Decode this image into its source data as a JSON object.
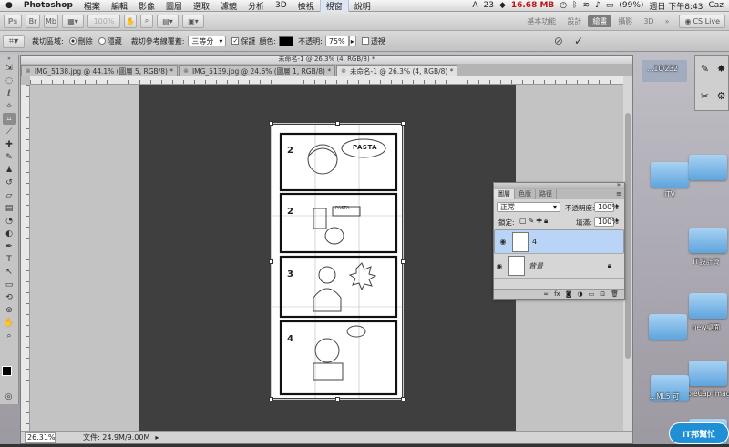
{
  "menubar": {
    "app_name": "Photoshop",
    "menus": [
      "檔案",
      "編輯",
      "影像",
      "圖層",
      "選取",
      "濾鏡",
      "分析",
      "3D",
      "檢視",
      "視窗",
      "說明"
    ],
    "status": {
      "adobe_count": "23",
      "memory": "16.68 MB",
      "battery": "(99%)",
      "datetime": "週日 下午8:43",
      "user": "Caz"
    }
  },
  "appbar": {
    "zoom_value": "100%",
    "workspaces": [
      "基本功能",
      "設計",
      "繪畫",
      "攝影",
      "3D"
    ],
    "active_workspace": "繪畫",
    "cs_live": "CS Live"
  },
  "options": {
    "crop_area_label": "裁切區域:",
    "delete_label": "刪除",
    "hide_label": "隱藏",
    "overlay_label": "裁切參考線覆蓋:",
    "overlay_value": "三等分",
    "shield_label": "保護",
    "color_label": "顏色:",
    "opacity_label": "不透明:",
    "opacity_value": "75%",
    "perspective_label": "透視",
    "cancel_glyph": "⊘",
    "commit_glyph": "✓"
  },
  "document": {
    "window_title": "未命名-1 @ 26.3% (4, RGB/8) *",
    "tabs": [
      {
        "label": "IMG_5138.jpg @ 44.1% (圖層 5, RGB/8) *",
        "active": false
      },
      {
        "label": "IMG_5139.jpg @ 24.6% (圖層 1, RGB/8) *",
        "active": false
      },
      {
        "label": "未命名-1 @ 26.3% (4, RGB/8) *",
        "active": true
      }
    ],
    "zoom": "26.31%",
    "file_info": "文件: 24.9M/9.00M"
  },
  "comic": {
    "panel_numbers": [
      "2",
      "2",
      "3",
      "4"
    ],
    "bubble_text": "PASTA",
    "small_text": "PASTA"
  },
  "layers_panel": {
    "tabs": [
      "圖層",
      "色版",
      "路徑"
    ],
    "blend_mode": "正常",
    "opacity_label": "不透明度:",
    "opacity_value": "100%",
    "lock_label": "鎖定:",
    "fill_label": "填滿:",
    "fill_value": "100%",
    "layers": [
      {
        "name": "4",
        "selected": true
      },
      {
        "name": "背景",
        "selected": false
      }
    ],
    "footer_fx": "fx"
  },
  "desktop": {
    "icons": [
      {
        "label": "iTV"
      },
      {
        "label": "IT設計資"
      },
      {
        "label": "new桌面"
      },
      {
        "label": "SimpleCap Images"
      }
    ],
    "partial_labels": [
      "…10/232",
      "…ML5 可"
    ],
    "badge": "IT邦幫忙"
  },
  "colors": {
    "canvas": "#3f3f3f",
    "selected_layer": "#b9d4f6",
    "memory_text": "#c0151a",
    "folder": "#6aaee2"
  }
}
